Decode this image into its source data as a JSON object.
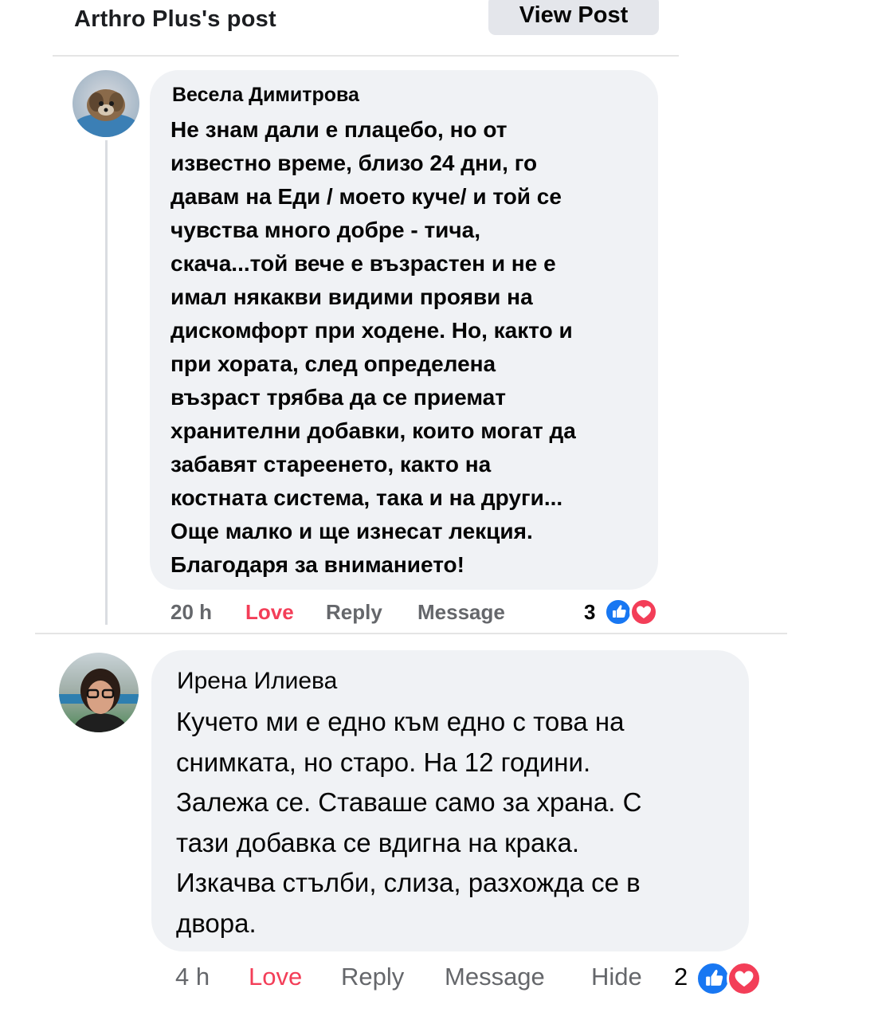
{
  "header": {
    "title": "Arthro Plus's post",
    "view_post_label": "View Post"
  },
  "comments": [
    {
      "author": "Весела Димитрова",
      "text": "Не знам дали е плацебо, но от\nизвестно време, близо 24 дни, го\nдавам на Еди / моето куче/ и той се\nчувства много добре - тича,\nскача...той вече е възрастен и не е\nимал някакви видими прояви на\nдискомфорт при ходене. Но, както и\nпри хората, след определена\nвъзраст трябва да се приемат\nхранителни добавки, които могат да\nзабавят стареенето, както на\nкостната система, така и на други...\nОще малко и ще изнесат лекция.\nБлагодаря за вниманието!",
      "time": "20 h",
      "love_label": "Love",
      "reply_label": "Reply",
      "message_label": "Message",
      "reaction_count": "3",
      "reactions": [
        "like-icon",
        "love-icon"
      ]
    },
    {
      "author": "Ирена Илиева",
      "text": "Кучето ми е  едно към едно с това на\nснимката,  но старо. На 12 години.\nЗалежа се. Ставаше само за храна. С\nтази добавка се вдигна на крака.\nИзкачва стълби, слиза, разхожда се в\nдвора.",
      "time": "4 h",
      "love_label": "Love",
      "reply_label": "Reply",
      "message_label": "Message",
      "hide_label": "Hide",
      "reaction_count": "2",
      "reactions": [
        "like-icon",
        "love-icon"
      ]
    }
  ],
  "colors": {
    "love": "#f33e58",
    "like": "#1877f2",
    "meta": "#65676b",
    "bubble": "#f0f2f5"
  }
}
